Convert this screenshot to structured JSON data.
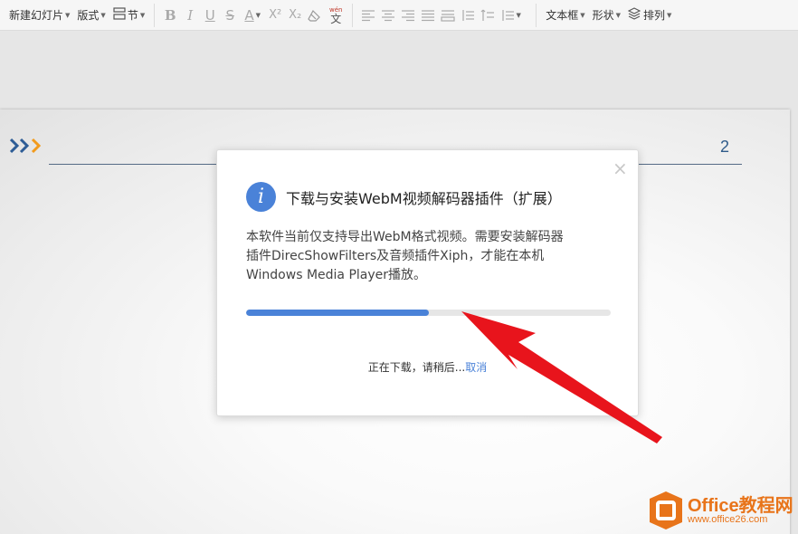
{
  "toolbar": {
    "new_slide": "新建幻灯片",
    "layout": "版式",
    "section": "节",
    "text_style": "A",
    "superscript": "X²",
    "subscript": "X₂",
    "phonetic_top": "wén",
    "phonetic_char": "文",
    "textbox": "文本框",
    "shape": "形状",
    "arrange": "排列"
  },
  "slide": {
    "page_number": "2"
  },
  "dialog": {
    "info_icon": "i",
    "title": "下载与安装WebM视频解码器插件（扩展）",
    "body": "本软件当前仅支持导出WebM格式视频。需要安装解码器\n插件DirecShowFilters及音频插件Xiph，才能在本机\nWindows Media Player播放。",
    "progress": 0.5,
    "status": "正在下载，请稍后...",
    "cancel": "取消",
    "close_glyph": "×"
  },
  "watermark": {
    "name": "Office教程网",
    "url": "www.office26.com"
  },
  "colors": {
    "accent_blue": "#4a82d8",
    "arrow_red": "#e8141c",
    "watermark_orange": "#e8741a"
  }
}
